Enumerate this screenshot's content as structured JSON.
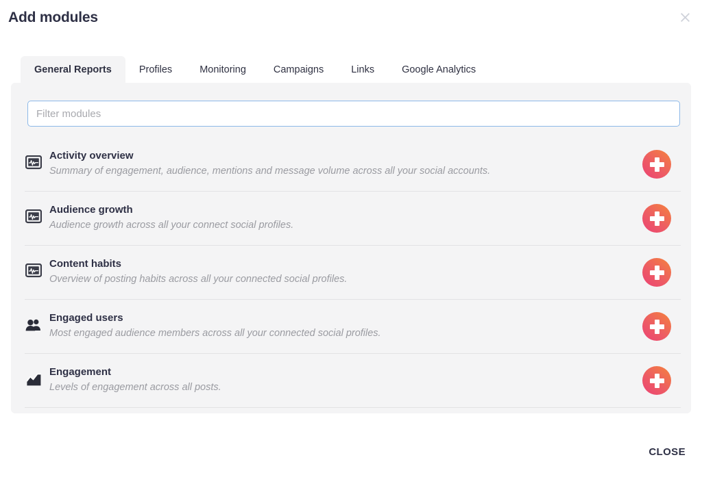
{
  "header": {
    "title": "Add modules",
    "close_icon": "close-x-icon"
  },
  "tabs": [
    {
      "label": "General Reports",
      "active": true
    },
    {
      "label": "Profiles",
      "active": false
    },
    {
      "label": "Monitoring",
      "active": false
    },
    {
      "label": "Campaigns",
      "active": false
    },
    {
      "label": "Links",
      "active": false
    },
    {
      "label": "Google Analytics",
      "active": false
    }
  ],
  "filter": {
    "placeholder": "Filter modules",
    "value": ""
  },
  "modules": [
    {
      "name": "Activity overview",
      "description": "Summary of engagement, audience, mentions and message volume across all your social accounts.",
      "icon": "monitor-pulse-icon",
      "add_label": "add-module-button"
    },
    {
      "name": "Audience growth",
      "description": "Audience growth across all your connect social profiles.",
      "icon": "monitor-pulse-icon",
      "add_label": "add-module-button"
    },
    {
      "name": "Content habits",
      "description": "Overview of posting habits across all your connected social profiles.",
      "icon": "monitor-pulse-icon",
      "add_label": "add-module-button"
    },
    {
      "name": "Engaged users",
      "description": "Most engaged audience members across all your connected social profiles.",
      "icon": "users-group-icon",
      "add_label": "add-module-button"
    },
    {
      "name": "Engagement",
      "description": "Levels of engagement across all posts.",
      "icon": "area-chart-icon",
      "add_label": "add-module-button"
    }
  ],
  "footer": {
    "close_label": "CLOSE"
  },
  "colors": {
    "title_text": "#2e3045",
    "panel_bg": "#f4f4f5",
    "input_border_focus": "#8cb8e8",
    "description_text": "#9a9ba1",
    "add_gradient_start": "#ec4274",
    "add_gradient_end": "#f4833d",
    "divider": "#e2e2e4",
    "close_icon": "#cfd2da"
  }
}
